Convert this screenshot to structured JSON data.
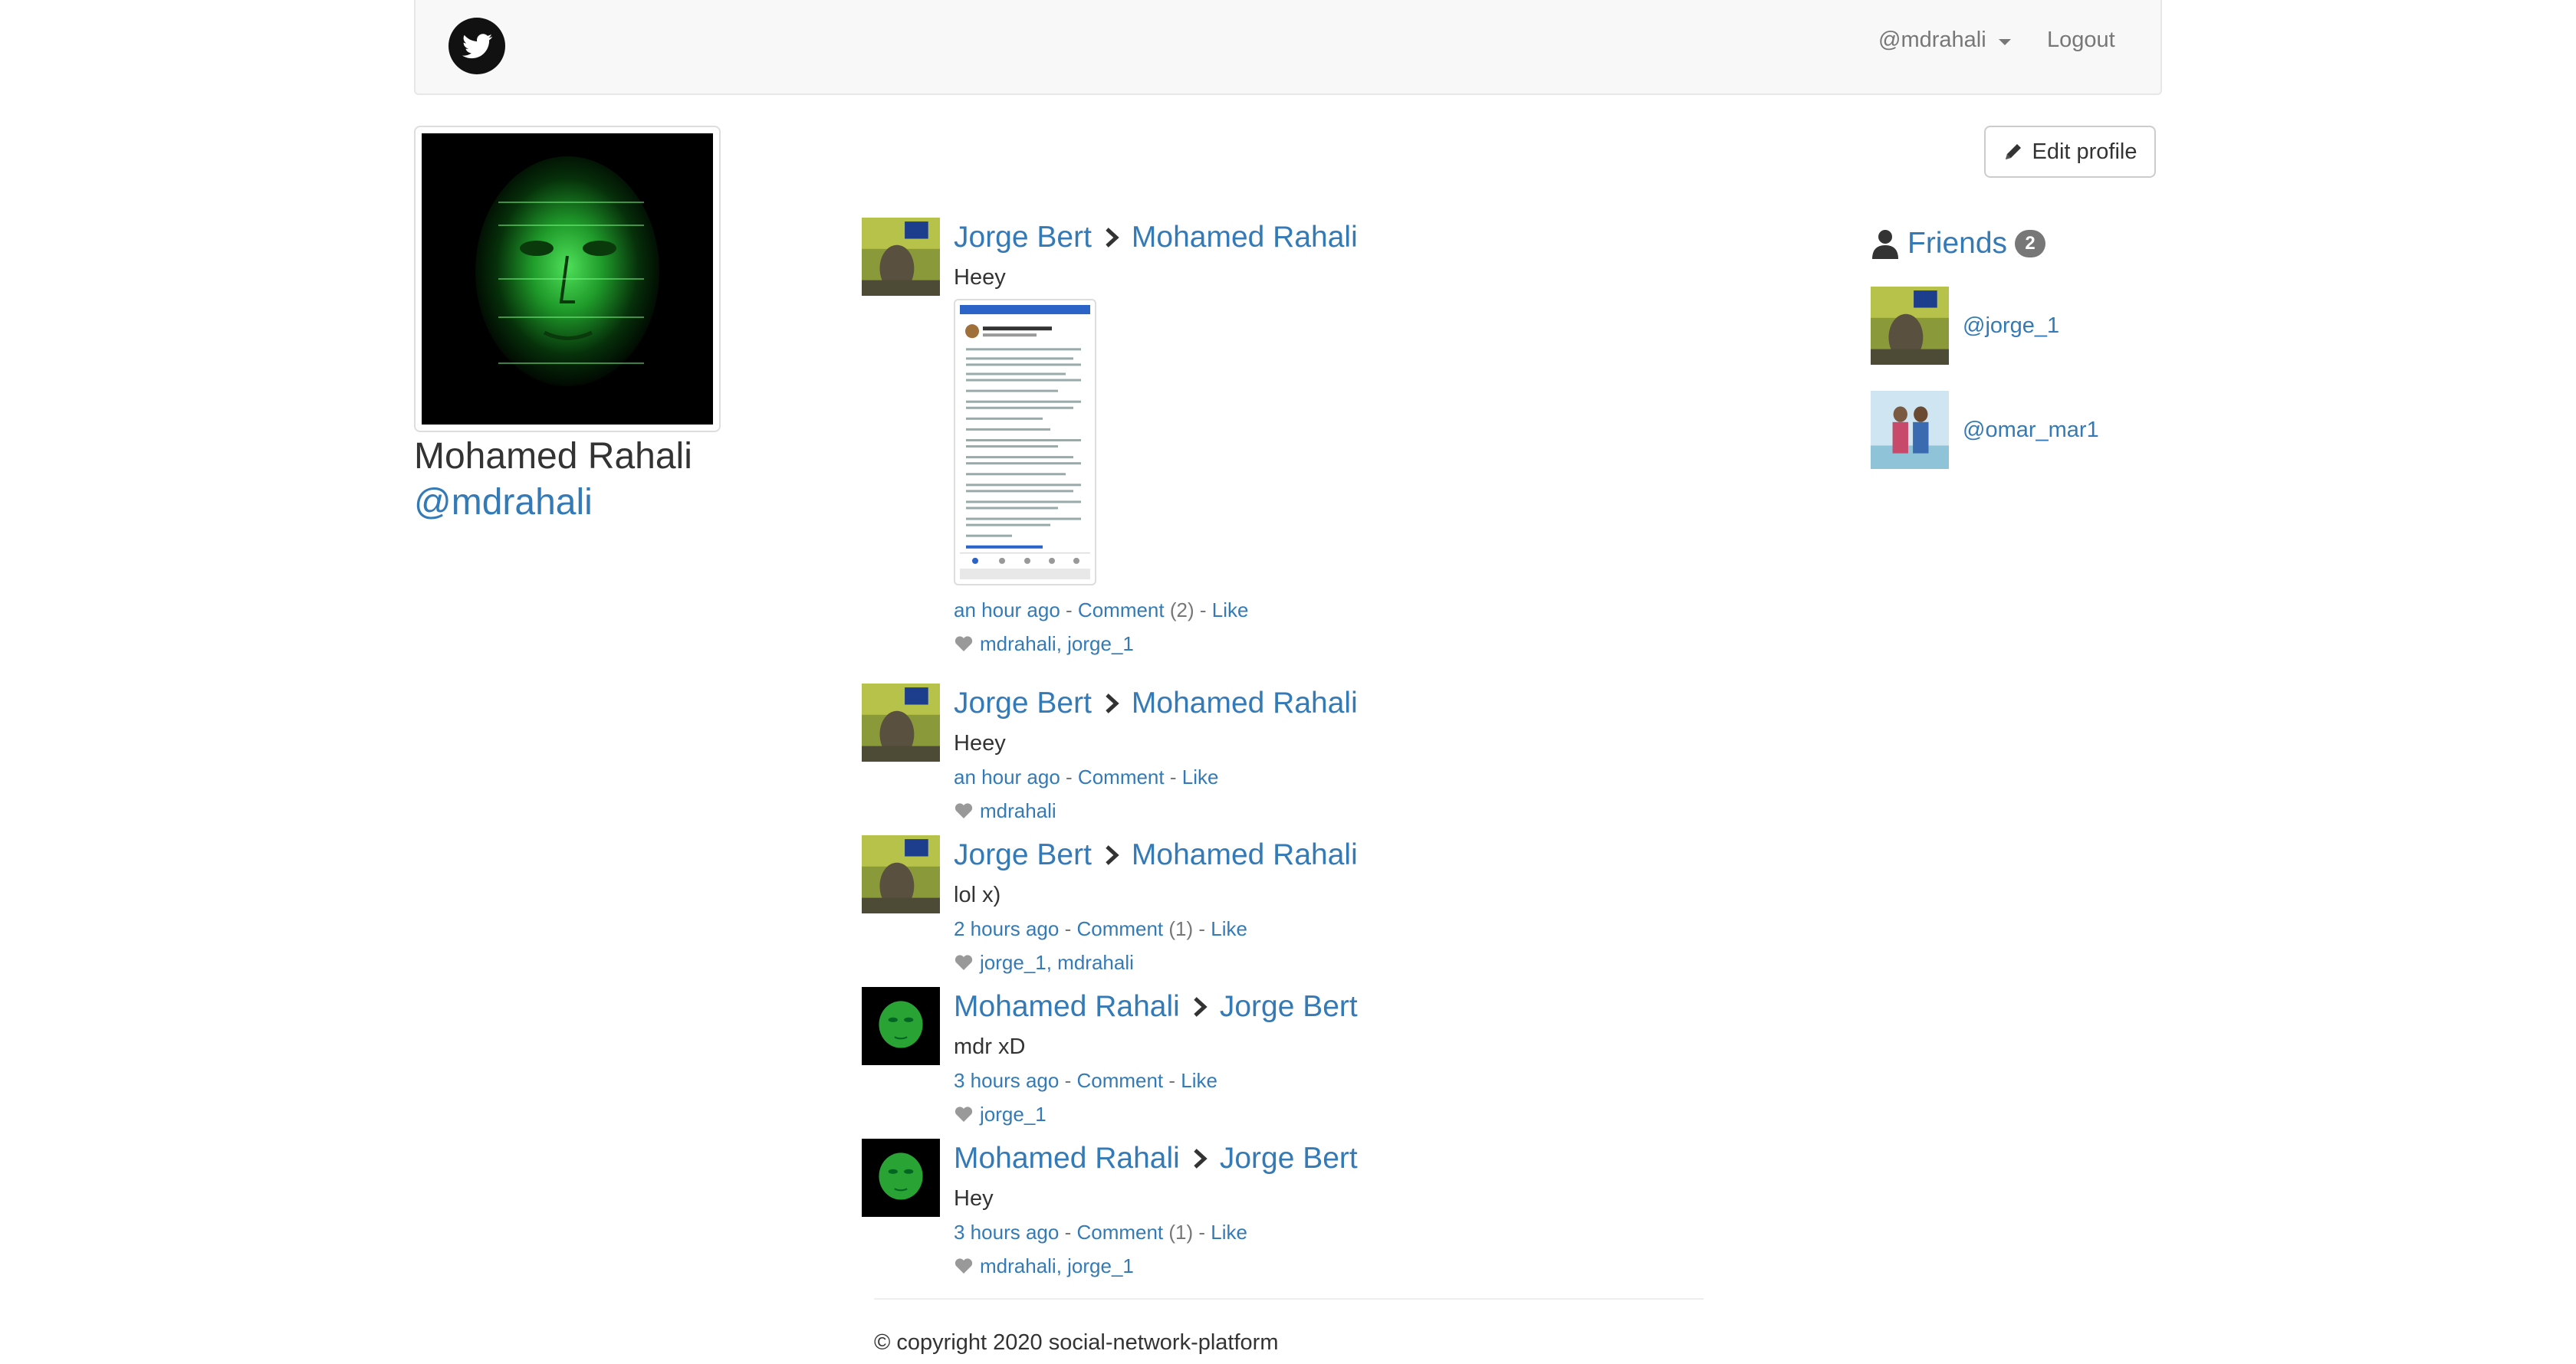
{
  "navbar": {
    "logo_icon": "twitter-bird-icon",
    "user_menu_label": "@mdrahali",
    "logout_label": "Logout"
  },
  "profile": {
    "name": "Mohamed Rahali",
    "handle": "@mdrahali",
    "edit_label": "Edit profile"
  },
  "feed": {
    "posts": [
      {
        "author": "Jorge Bert",
        "recipient": "Mohamed Rahali",
        "text": "Heey",
        "has_image": true,
        "time": "an hour ago",
        "comment_label": "Comment",
        "comment_count": "(2)",
        "like_label": "Like",
        "likes": "mdrahali, jorge_1"
      },
      {
        "author": "Jorge Bert",
        "recipient": "Mohamed Rahali",
        "text": "Heey",
        "time": "an hour ago",
        "comment_label": "Comment",
        "comment_count": "",
        "like_label": "Like",
        "likes": "mdrahali"
      },
      {
        "author": "Jorge Bert",
        "recipient": "Mohamed Rahali",
        "text": "lol x)",
        "time": "2 hours ago",
        "comment_label": "Comment",
        "comment_count": "(1)",
        "like_label": "Like",
        "likes": "jorge_1, mdrahali"
      },
      {
        "author": "Mohamed Rahali",
        "recipient": "Jorge Bert",
        "text": "mdr xD",
        "time": "3 hours ago",
        "comment_label": "Comment",
        "comment_count": "",
        "like_label": "Like",
        "likes": "jorge_1"
      },
      {
        "author": "Mohamed Rahali",
        "recipient": "Jorge Bert",
        "text": "Hey",
        "time": "3 hours ago",
        "comment_label": "Comment",
        "comment_count": "(1)",
        "like_label": "Like",
        "likes": "mdrahali, jorge_1"
      }
    ]
  },
  "friends": {
    "title": "Friends",
    "count": "2",
    "items": [
      {
        "handle": "@jorge_1"
      },
      {
        "handle": "@omar_mar1"
      }
    ]
  },
  "footer": {
    "copyright": "© copyright 2020 social-network-platform"
  },
  "colors": {
    "link": "#337ab7",
    "navbar_bg": "#f8f8f8",
    "badge": "#777777",
    "muted": "#777777"
  }
}
